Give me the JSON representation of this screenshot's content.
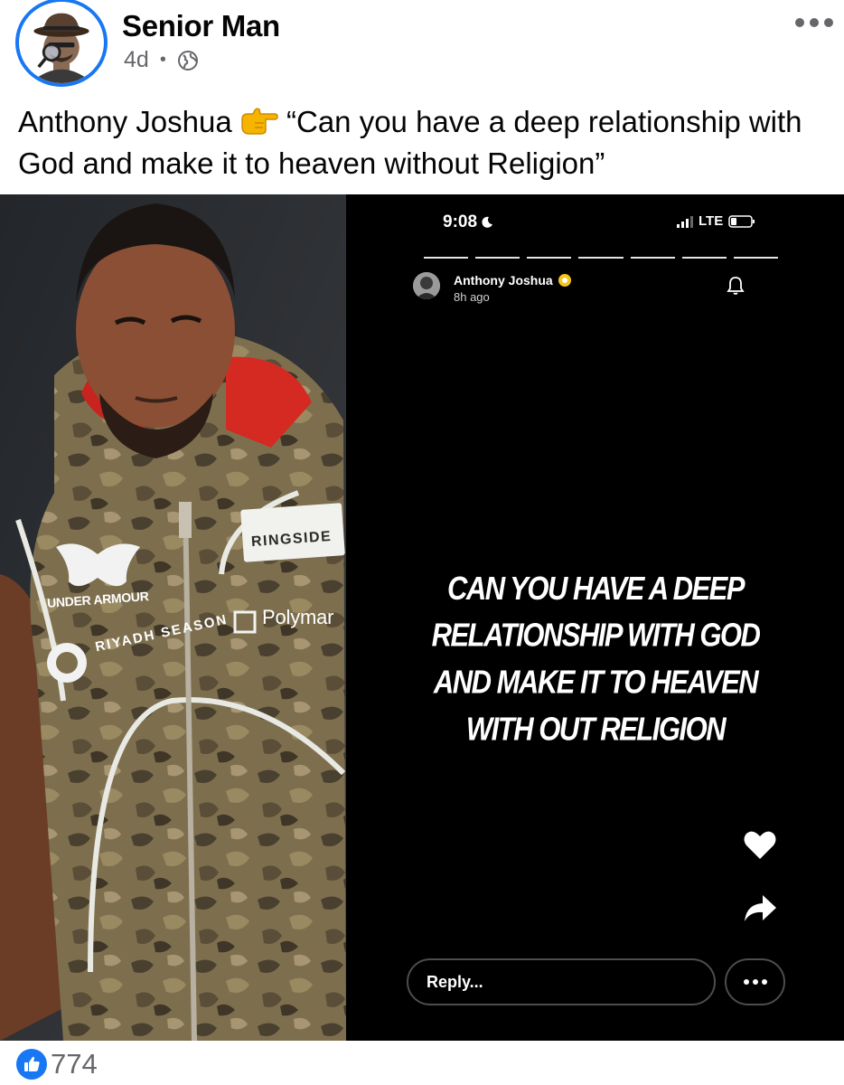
{
  "post": {
    "author": "Senior Man",
    "age": "4d",
    "separator": "•",
    "caption_before": "Anthony Joshua ",
    "caption_after": " “Can you have a deep relationship with God and make it to heaven without Religion”",
    "caption_emoji_icon": "pointing-right-hand-icon"
  },
  "photo": {
    "brand_under_armour": "UNDER ARMOUR",
    "brand_riyadh": "RIYADH SEASON",
    "brand_polymarket": "Polymar",
    "brand_ringside": "RINGSIDE"
  },
  "story": {
    "time": "9:08",
    "network": "LTE",
    "account_name": "Anthony Joshua",
    "posted": "8h ago",
    "text": "Can you have a deep relationship with God and make it to heaven with out religion",
    "reply_placeholder": "Reply...",
    "progress_segments_total": 7,
    "progress_segments_viewed": 7
  },
  "footer": {
    "like_count": "774"
  },
  "colors": {
    "facebook_blue": "#1877f2",
    "secondary_text": "#65676b",
    "verified_badge": "#f5c518"
  }
}
